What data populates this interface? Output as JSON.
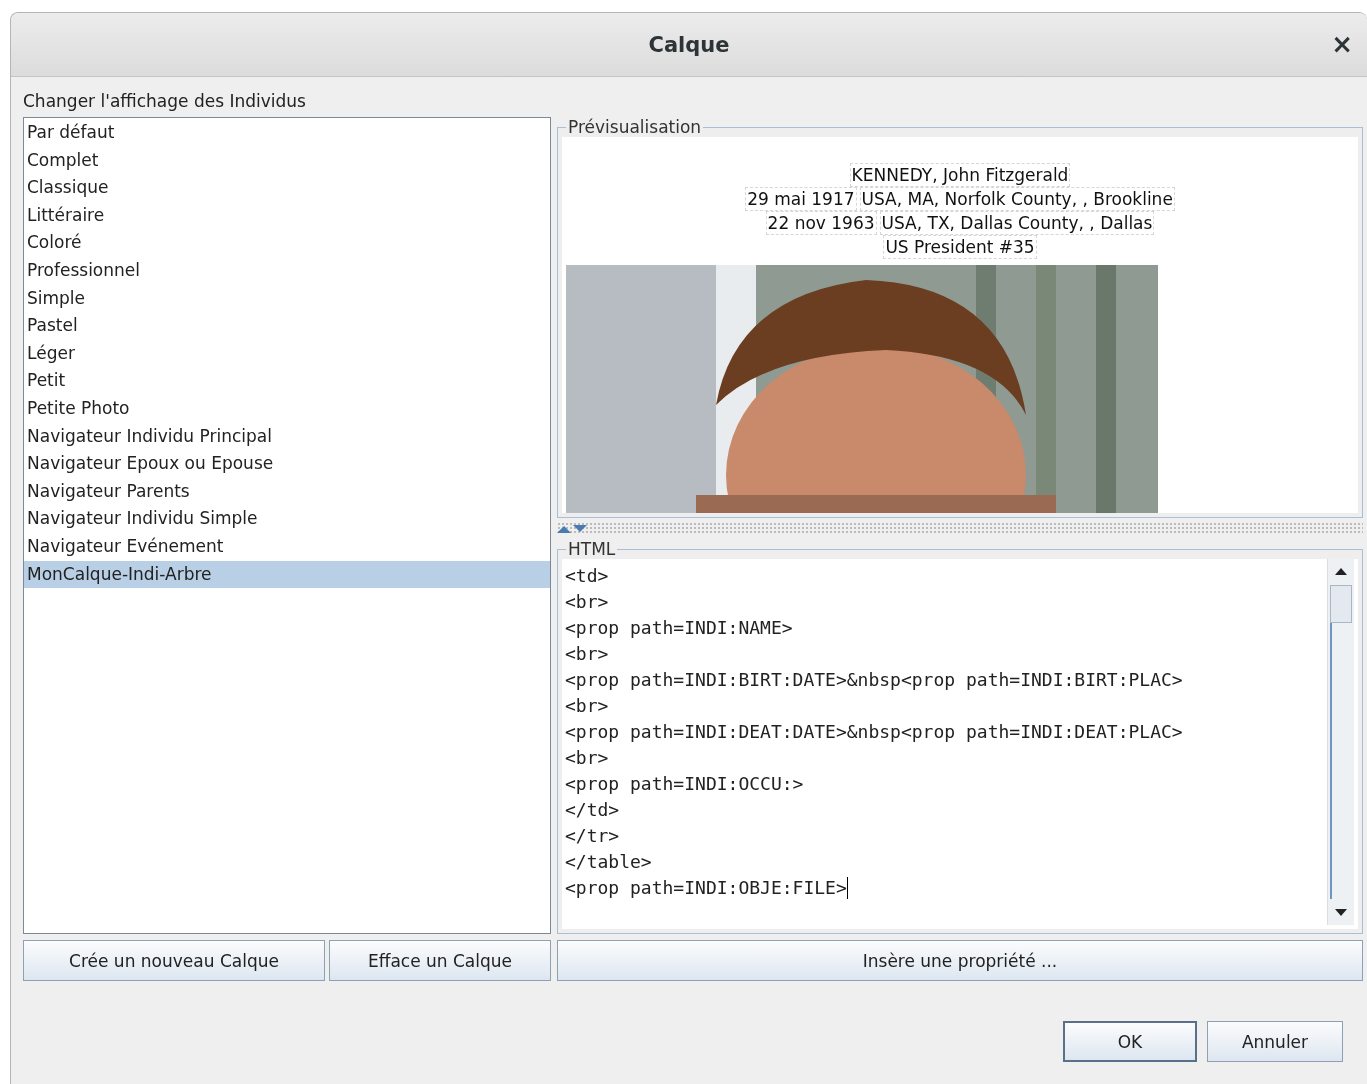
{
  "window": {
    "title": "Calque",
    "close": "×"
  },
  "layers": {
    "label": "Changer l'affichage des Individus",
    "items": [
      {
        "label": "Par défaut",
        "selected": false
      },
      {
        "label": "Complet",
        "selected": false
      },
      {
        "label": "Classique",
        "selected": false
      },
      {
        "label": "Littéraire",
        "selected": false
      },
      {
        "label": "Coloré",
        "selected": false
      },
      {
        "label": "Professionnel",
        "selected": false
      },
      {
        "label": "Simple",
        "selected": false
      },
      {
        "label": "Pastel",
        "selected": false
      },
      {
        "label": "Léger",
        "selected": false
      },
      {
        "label": "Petit",
        "selected": false
      },
      {
        "label": "Petite Photo",
        "selected": false
      },
      {
        "label": "Navigateur Individu Principal",
        "selected": false
      },
      {
        "label": "Navigateur Epoux ou Epouse",
        "selected": false
      },
      {
        "label": "Navigateur Parents",
        "selected": false
      },
      {
        "label": "Navigateur Individu Simple",
        "selected": false
      },
      {
        "label": "Navigateur Evénement",
        "selected": false
      },
      {
        "label": "MonCalque-Indi-Arbre",
        "selected": true
      }
    ],
    "buttons": [
      "Crée un nouveau Calque",
      "Efface un Calque"
    ]
  },
  "preview": {
    "title": "Prévisualisation",
    "lines": [
      [
        "KENNEDY, John Fitzgerald"
      ],
      [
        "29 mai 1917",
        "USA, MA, Norfolk County, , Brookline"
      ],
      [
        "22 nov 1963",
        "USA, TX, Dallas County, , Dallas"
      ],
      [
        "US President #35"
      ]
    ],
    "photo": {
      "kind": "picture"
    }
  },
  "html": {
    "title": "HTML",
    "lines": [
      "<td>",
      "<br>",
      "<prop path=INDI:NAME>",
      "<br>",
      "<prop path=INDI:BIRT:DATE>&nbsp<prop path=INDI:BIRT:PLAC>",
      "<br>",
      "<prop path=INDI:DEAT:DATE>&nbsp<prop path=INDI:DEAT:PLAC>",
      "<br>",
      "<prop path=INDI:OCCU:>",
      "</td>",
      "</tr>",
      "</table>",
      "<prop path=INDI:OBJE:FILE>"
    ],
    "insert_button": "Insère une propriété ..."
  },
  "buttons": [
    {
      "label": "OK",
      "default": true
    },
    {
      "label": "Annuler",
      "default": false
    }
  ]
}
